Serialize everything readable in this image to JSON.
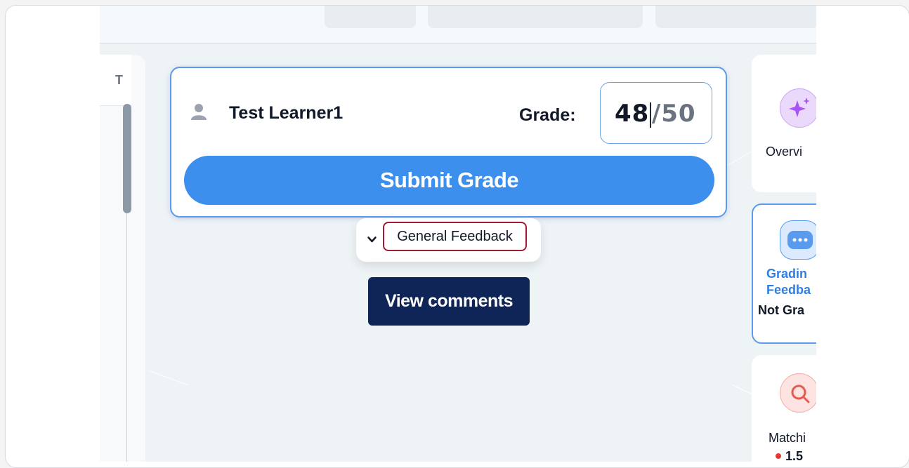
{
  "left_panel": {
    "tab_letter": "T"
  },
  "grade_card": {
    "learner_name": "Test Learner1",
    "grade_label": "Grade:",
    "grade_value": "48",
    "grade_total": "/50",
    "submit_label": "Submit Grade"
  },
  "feedback": {
    "label": "General Feedback"
  },
  "view_comments_label": "View comments",
  "tools": {
    "overview_label": "Overvi",
    "grading_line1": "Gradin",
    "grading_line2": "Feedba",
    "grading_status": "Not Gra",
    "matching_label": "Matchi",
    "matching_extra": "1.5"
  },
  "colors": {
    "primary": "#3d8fee",
    "navy": "#0f2557",
    "highlight_border": "#a01c33",
    "status_red": "#e53935"
  }
}
